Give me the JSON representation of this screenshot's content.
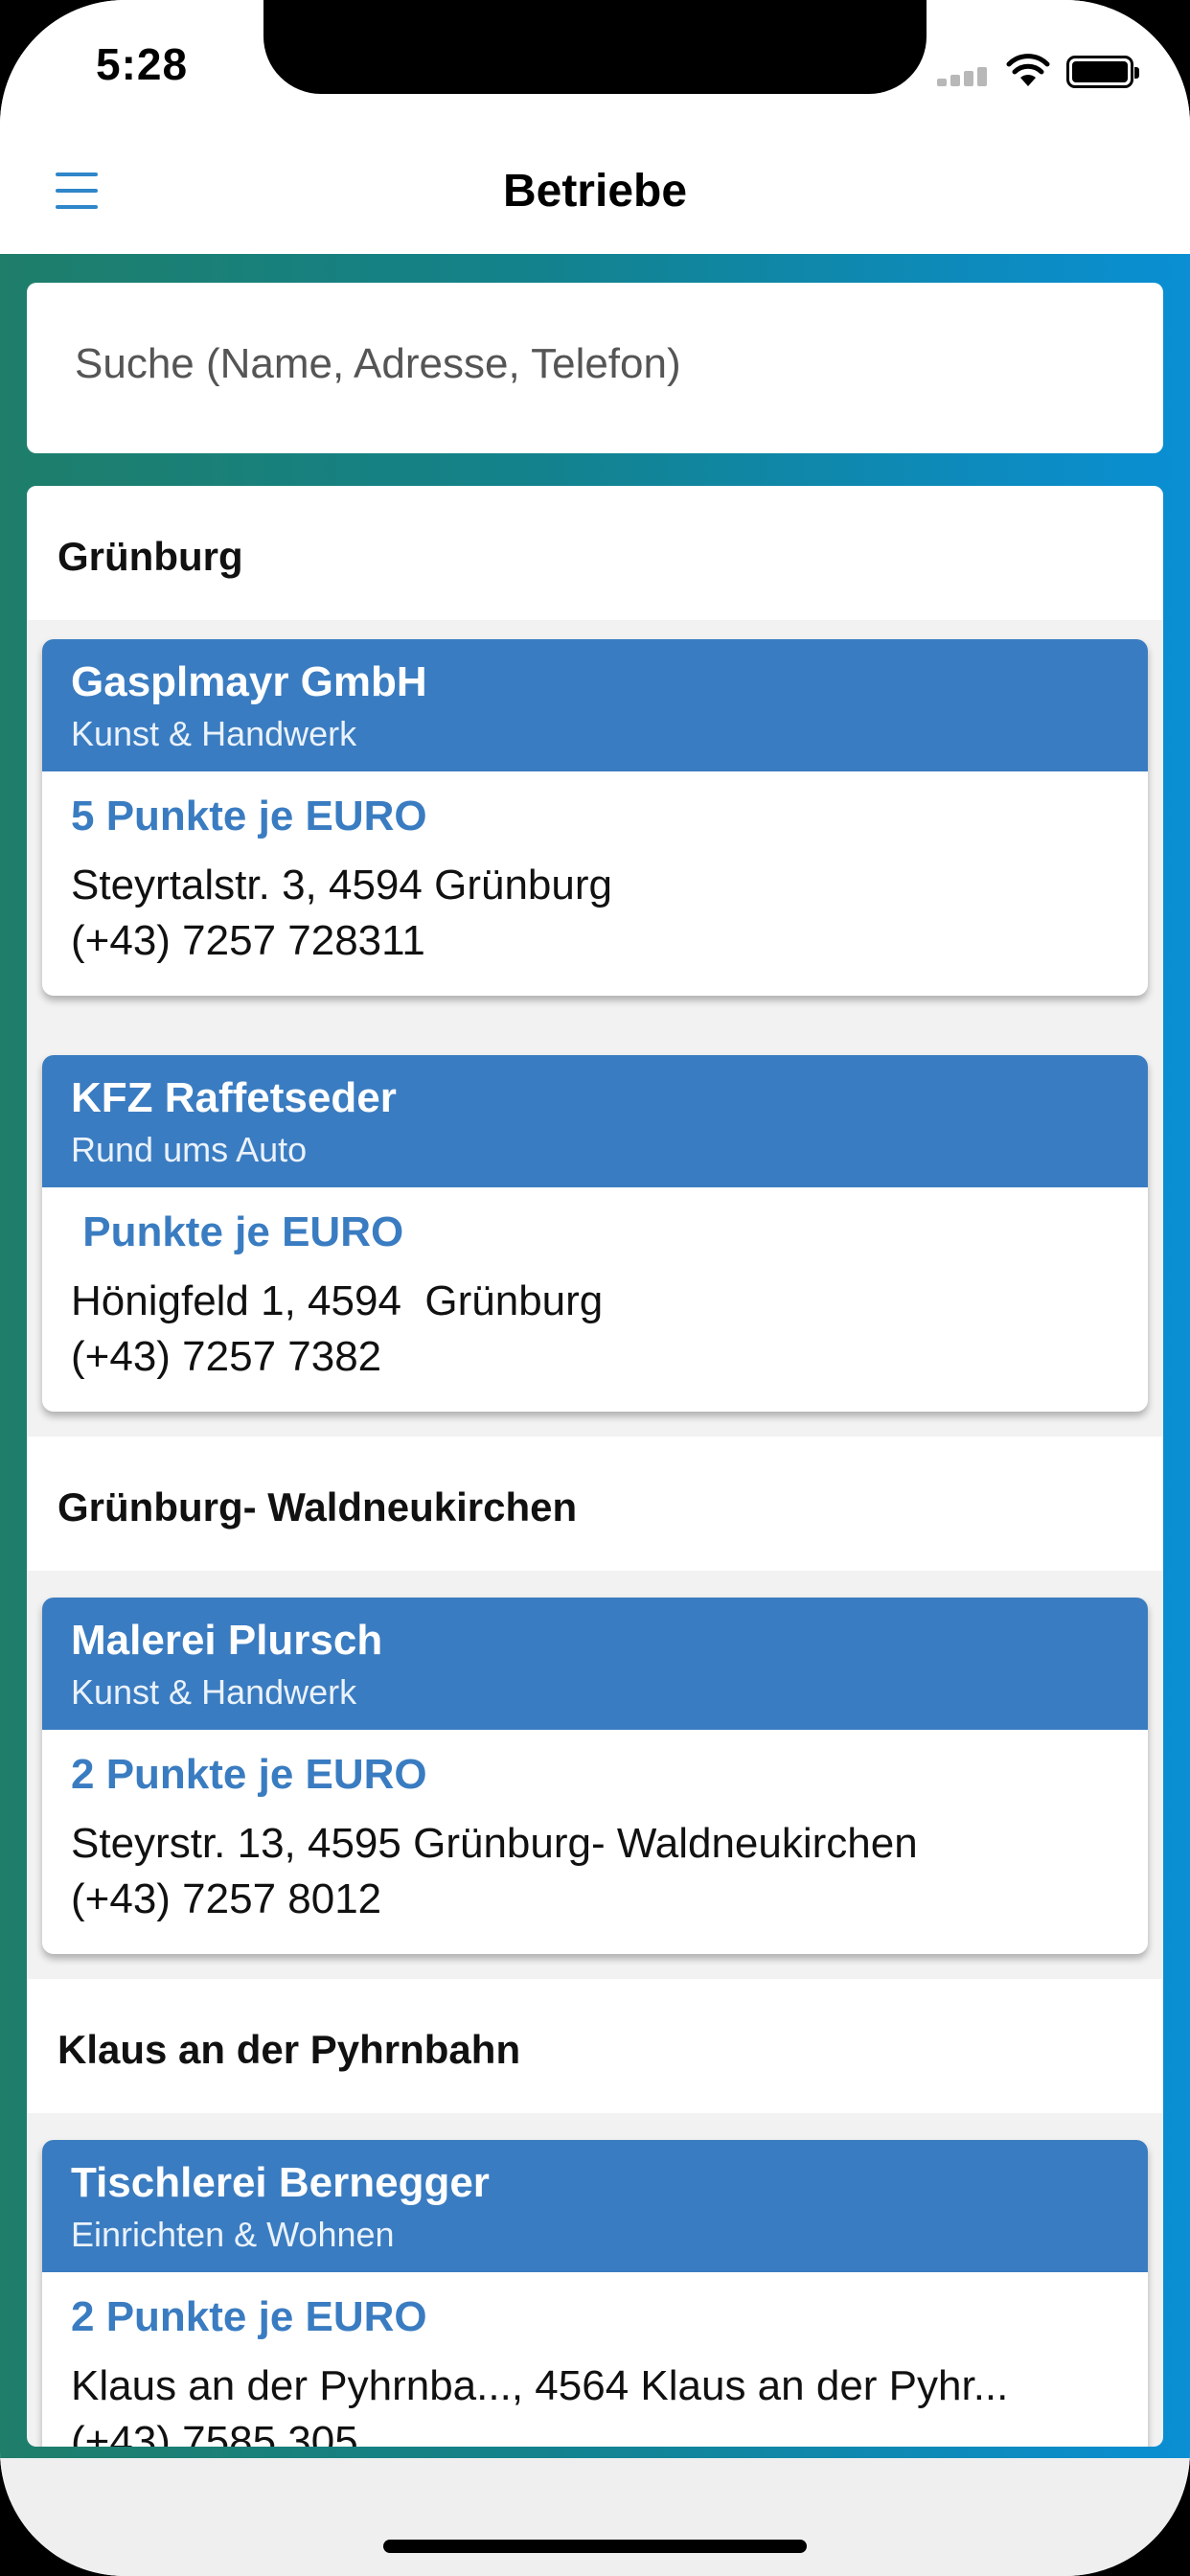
{
  "status_bar": {
    "time": "5:28"
  },
  "navbar": {
    "title": "Betriebe",
    "menu_icon": "hamburger-menu-icon"
  },
  "search": {
    "placeholder": "Suche (Name, Adresse, Telefon)"
  },
  "groups": [
    {
      "name": "Grünburg",
      "businesses": [
        {
          "name": "Gasplmayr GmbH",
          "category": "Kunst & Handwerk",
          "points": "5 Punkte je EURO",
          "address": "Steyrtalstr. 3, 4594 Grünburg",
          "phone": "(+43) 7257 728311"
        },
        {
          "name": "KFZ Raffetseder",
          "category": "Rund ums Auto",
          "points": " Punkte je EURO",
          "address": "Hönigfeld 1, 4594  Grünburg",
          "phone": "(+43) 7257 7382"
        }
      ]
    },
    {
      "name": "Grünburg- Waldneukirchen",
      "businesses": [
        {
          "name": "Malerei Plursch",
          "category": "Kunst & Handwerk",
          "points": "2 Punkte je EURO",
          "address": "Steyrstr. 13, 4595 Grünburg- Waldneukirchen",
          "phone": "(+43) 7257 8012"
        }
      ]
    },
    {
      "name": "Klaus an der Pyhrnbahn",
      "businesses": [
        {
          "name": "Tischlerei Bernegger",
          "category": "Einrichten & Wohnen",
          "points": "2 Punkte je EURO",
          "address": "Klaus an der Pyhrnba..., 4564 Klaus an der Pyhr...",
          "phone": "(+43) 7585 305"
        }
      ]
    }
  ],
  "colors": {
    "accent": "#3a7cc1",
    "gradient_start": "#1e7e6a",
    "gradient_end": "#0a8fd4"
  }
}
